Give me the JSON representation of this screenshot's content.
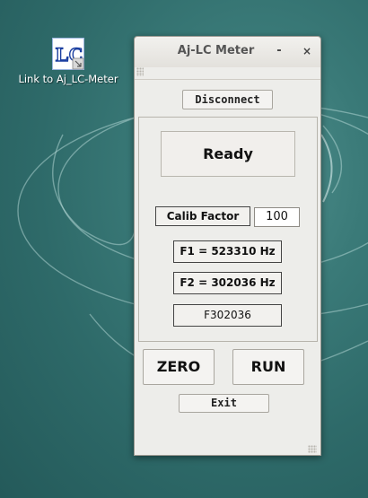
{
  "desktop": {
    "icon_label": "Link to Aj_LC-Meter",
    "icon_name": "lc-meter-shortcut-icon",
    "background_color": "#2e6a69"
  },
  "window": {
    "title": "Aj-LC Meter",
    "minimize_label": "-",
    "close_label": "×",
    "disconnect_label": "Disconnect",
    "status_text": "Ready",
    "calib_factor_label": "Calib Factor",
    "calib_factor_value": "100",
    "f1_text": "F1 = 523310 Hz",
    "f2_text": "F2 = 302036 Hz",
    "raw_text": "F302036",
    "zero_label": "ZERO",
    "run_label": "RUN",
    "exit_label": "Exit"
  }
}
